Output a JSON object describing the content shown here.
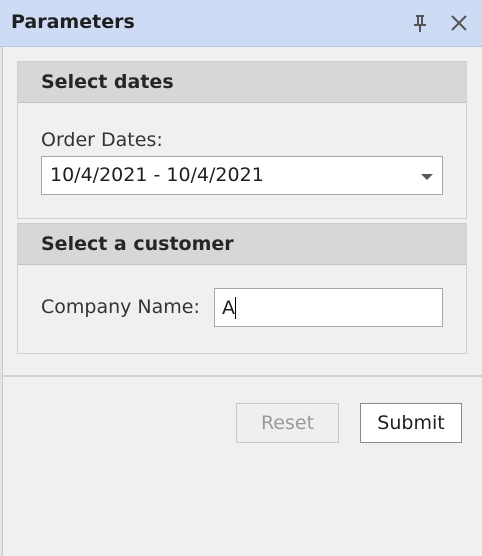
{
  "panel": {
    "title": "Parameters",
    "pin_icon": "pin-icon",
    "close_icon": "close-icon"
  },
  "groups": [
    {
      "header": "Select dates",
      "field_label": "Order Dates:",
      "field_value": "10/4/2021 - 10/4/2021",
      "field_type": "combo"
    },
    {
      "header": "Select a customer",
      "field_label": "Company Name:",
      "field_value": "A",
      "field_type": "text"
    }
  ],
  "buttons": {
    "reset": "Reset",
    "submit": "Submit"
  },
  "colors": {
    "titlebar": "#cddcf4",
    "group_header": "#d7d7d7",
    "background": "#f0f0f0"
  }
}
